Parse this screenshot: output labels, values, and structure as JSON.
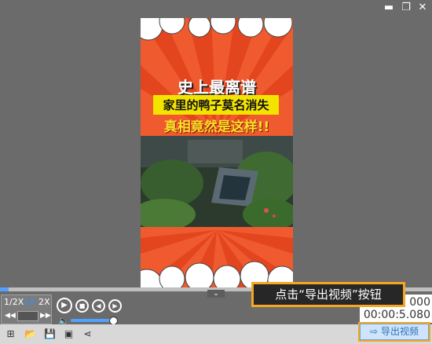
{
  "window": {
    "minimize_icon": "minimize-icon",
    "restore_icon": "restore-icon",
    "close_icon": "close-icon"
  },
  "video": {
    "caption_line1": "史上最离谱",
    "caption_line2": "家里的鸭子莫名消失",
    "caption_line3": "真相竟然是这样!!"
  },
  "playback": {
    "speeds": [
      "1/2X",
      "1X",
      "2X"
    ],
    "active_speed": "1X",
    "progress_percent": 2,
    "volume_percent": 100,
    "time_current": "000",
    "time_total": "00:00:5.080",
    "collapse_glyph": "⌄"
  },
  "callout": {
    "text": "点击“导出视频”按钮"
  },
  "toolbar": {
    "icons": [
      "new-project-icon",
      "open-folder-icon",
      "save-icon",
      "save-as-icon",
      "share-icon"
    ],
    "export_label": "导出视频"
  },
  "colors": {
    "accent": "#4fa3ff",
    "highlight": "#f5a623",
    "poster_red": "#ef5a2f"
  }
}
